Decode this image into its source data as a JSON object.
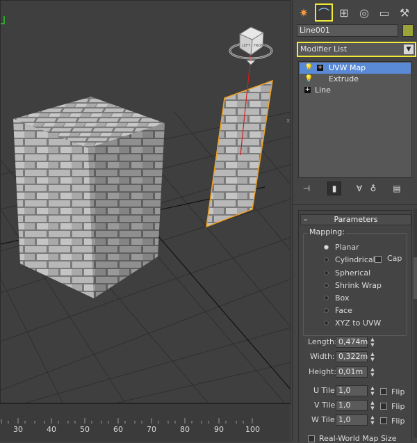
{
  "viewport": {
    "corner_bracket_color": "#22cc22"
  },
  "ruler": {
    "ticks": [
      "30",
      "40",
      "50",
      "60",
      "70",
      "80",
      "90",
      "100"
    ]
  },
  "command_panel": {
    "tabs": [
      {
        "name": "create-tab",
        "icon": "sun-star-icon",
        "glyph": "✷"
      },
      {
        "name": "modify-tab",
        "icon": "modify-arc-icon",
        "glyph": "⌒"
      },
      {
        "name": "hierarchy-tab",
        "icon": "hierarchy-icon",
        "glyph": "⊞"
      },
      {
        "name": "motion-tab",
        "icon": "motion-circle-icon",
        "glyph": "◎"
      },
      {
        "name": "display-tab",
        "icon": "display-monitor-icon",
        "glyph": "▭"
      },
      {
        "name": "utilities-tab",
        "icon": "hammer-icon",
        "glyph": "⚒"
      }
    ],
    "object_name": "Line001",
    "object_color": "#9aa338",
    "modifier_list": "Modifier List",
    "dropdown_arrow": "▼",
    "stack": [
      {
        "label": "UVW Map",
        "selected": true
      },
      {
        "label": "Extrude",
        "selected": false
      },
      {
        "label": "Line",
        "selected": false
      }
    ],
    "parameters": {
      "title": "Parameters",
      "collapse": "–",
      "mapping_label": "Mapping:",
      "mapping_options": [
        "Planar",
        "Cylindrical",
        "Spherical",
        "Shrink Wrap",
        "Box",
        "Face",
        "XYZ to UVW"
      ],
      "selected_mapping": "Planar",
      "cap_label": "Cap",
      "length_label": "Length:",
      "length": "0,474m",
      "width_label": "Width:",
      "width": "0,322m",
      "height_label": "Height:",
      "height": "0,01m",
      "u_tile_label": "U Tile:",
      "u_tile": "1,0",
      "v_tile_label": "V Tile:",
      "v_tile": "1,0",
      "w_tile_label": "W Tile:",
      "w_tile": "1,0",
      "flip_label": "Flip",
      "real_world_label": "Real-World Map Size"
    }
  }
}
